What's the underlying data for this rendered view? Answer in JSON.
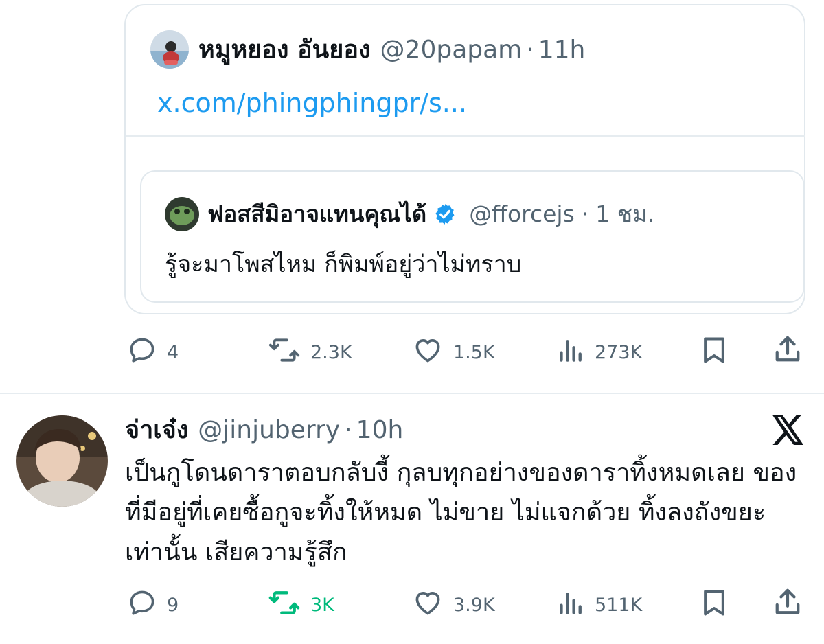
{
  "quoted_tweet": {
    "author_name": "หมูหยอง อันยอง",
    "handle": "@20papam",
    "dot": "·",
    "time": "11h",
    "link_text": "x.com/phingphingpr/s...",
    "inner_quote": {
      "author_name": "ฟอสสีมิอาจแทนคุณได้",
      "verified": true,
      "handle": "@fforcejs",
      "dot": "·",
      "time": "1 ชม.",
      "text": "รู้จะมาโพสไหม ก็พิมพ์อยู่ว่าไม่ทราบ"
    },
    "actions": {
      "replies": "4",
      "reposts": "2.3K",
      "likes": "1.5K",
      "views": "273K"
    }
  },
  "main_tweet": {
    "author_name": "จ่าเจ๋ง",
    "handle": "@jinjuberry",
    "dot": "·",
    "time": "10h",
    "text": "เป็นกูโดนดาราตอบกลับงี้ กุลบทุกอย่างของดาราทิ้งหมดเลย ของที่มีอยู่ที่เคยซื้อกูจะทิ้งให้หมด ไม่ขาย ไม่แจกด้วย ทิ้งลงถังขยะเท่านั้น เสียความรู้สึก",
    "actions": {
      "replies": "9",
      "reposts": "3K",
      "reposted": true,
      "likes": "3.9K",
      "views": "511K"
    }
  },
  "colors": {
    "text": "#0f1419",
    "muted": "#536471",
    "link": "#1d9bf0",
    "verified": "#1d9bf0",
    "repost_active": "#00ba7c",
    "border": "#e1e8ed"
  },
  "icons": [
    "reply-icon",
    "repost-icon",
    "like-icon",
    "views-icon",
    "bookmark-icon",
    "share-icon",
    "x-logo-icon",
    "verified-badge-icon"
  ]
}
